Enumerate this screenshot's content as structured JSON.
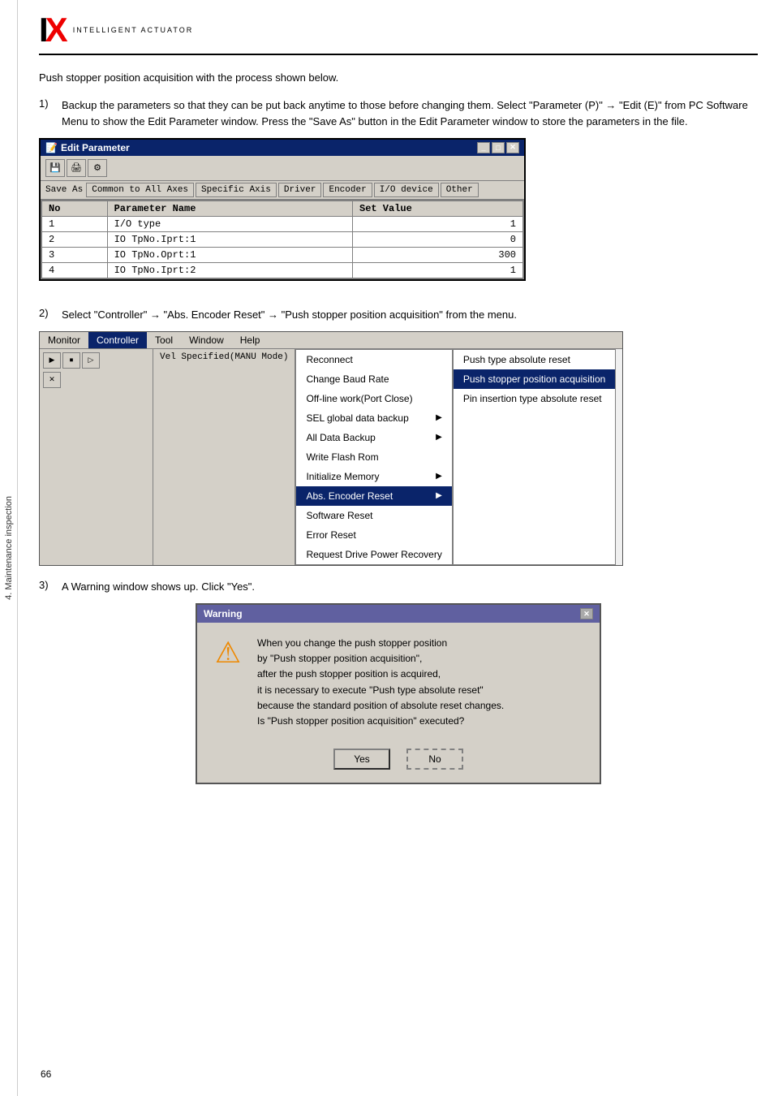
{
  "sidebar": {
    "label": "4. Maintenance inspection"
  },
  "header": {
    "logo_i": "I",
    "logo_x": "X",
    "subtitle": "INTELLIGENT ACTUATOR"
  },
  "intro": {
    "text": "Push stopper position acquisition with the process shown below."
  },
  "steps": {
    "step1": {
      "num": "1)",
      "text": "Backup the parameters so that they can be put back anytime to those before changing them. Select \"Parameter (P)\" → \"Edit (E)\" from PC Software Menu to show the Edit Parameter window. Press the \"Save As\" button in the Edit Parameter window to store the parameters in the file."
    },
    "step2": {
      "num": "2)",
      "text": "Select \"Controller\" → \"Abs. Encoder Reset\" → \"Push stopper position acquisition\" from the menu."
    },
    "step3": {
      "num": "3)",
      "text": "A Warning window shows up. Click \"Yes\"."
    }
  },
  "edit_param_window": {
    "title": "Edit Parameter",
    "tabs": {
      "save_as": "Save As",
      "common": "Common to All Axes",
      "specific": "Specific Axis",
      "driver": "Driver",
      "encoder": "Encoder",
      "io_device": "I/O device",
      "other": "Other"
    },
    "table": {
      "headers": [
        "No",
        "Parameter Name",
        "Set Value"
      ],
      "rows": [
        {
          "no": "1",
          "name": "I/O type",
          "value": "1"
        },
        {
          "no": "2",
          "name": "IO TpNo.Iprt:1",
          "value": "0"
        },
        {
          "no": "3",
          "name": "IO TpNo.Oprt:1",
          "value": "300"
        },
        {
          "no": "4",
          "name": "IO TpNo.Iprt:2",
          "value": "1"
        }
      ]
    }
  },
  "controller_menu": {
    "menu_items": [
      "Monitor",
      "Controller",
      "Tool",
      "Window",
      "Help"
    ],
    "active_item": "Controller",
    "dropdown_items": [
      {
        "label": "Reconnect",
        "has_arrow": false
      },
      {
        "label": "Change Baud Rate",
        "has_arrow": false
      },
      {
        "label": "Off-line work(Port Close)",
        "has_arrow": false
      },
      {
        "label": "SEL global data backup",
        "has_arrow": true
      },
      {
        "label": "All Data Backup",
        "has_arrow": true
      },
      {
        "label": "Write Flash Rom",
        "has_arrow": false
      },
      {
        "label": "Initialize Memory",
        "has_arrow": true
      },
      {
        "label": "Abs. Encoder Reset",
        "has_arrow": true,
        "highlighted": true
      },
      {
        "label": "Software Reset",
        "has_arrow": false
      },
      {
        "label": "Error Reset",
        "has_arrow": false
      },
      {
        "label": "Request Drive Power Recovery",
        "has_arrow": false
      }
    ],
    "submenu_items": [
      {
        "label": "Push type absolute reset",
        "selected": false
      },
      {
        "label": "Push stopper position acquisition",
        "selected": true
      },
      {
        "label": "Pin insertion type absolute reset",
        "selected": false
      }
    ],
    "vel_display": "Vel Specified(MANU Mode)"
  },
  "warning": {
    "title": "Warning",
    "icon": "⚠",
    "text": "When you change the push stopper position\nby \"Push stopper position acquisition\",\nafter the push stopper position is acquired,\nit is necessary to execute \"Push type absolute reset\"\nbecause the standard position of absolute reset changes.\nIs \"Push stopper position acquisition\" executed?",
    "yes_label": "Yes",
    "no_label": "No"
  },
  "page_num": "66"
}
